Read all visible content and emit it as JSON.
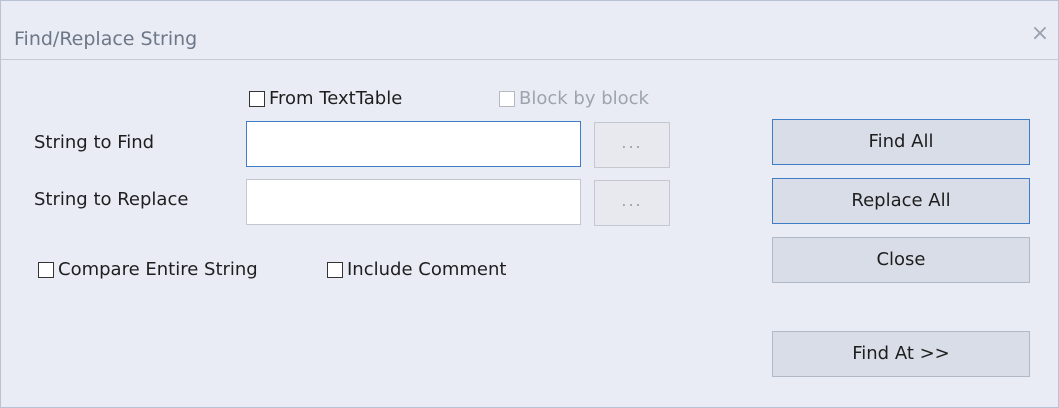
{
  "window": {
    "title": "Find/Replace String",
    "close_glyph": "×"
  },
  "options_top": {
    "from_texttable": {
      "label": "From TextTable",
      "checked": false
    },
    "block_by_block": {
      "label": "Block by block",
      "checked": false,
      "enabled": false
    }
  },
  "find": {
    "label": "String to Find",
    "value": "",
    "browse_label": "..."
  },
  "replace": {
    "label": "String to Replace",
    "value": "",
    "browse_label": "..."
  },
  "options_bottom": {
    "compare_entire": {
      "label": "Compare Entire String",
      "checked": false
    },
    "include_comment": {
      "label": "Include Comment",
      "checked": false
    }
  },
  "buttons": {
    "find_all": "Find All",
    "replace_all": "Replace All",
    "close": "Close",
    "find_at": "Find At >>"
  },
  "colors": {
    "dialog_bg": "#e9ecf5",
    "accent_border": "#3f7ec6",
    "button_bg": "#d9dde7"
  }
}
